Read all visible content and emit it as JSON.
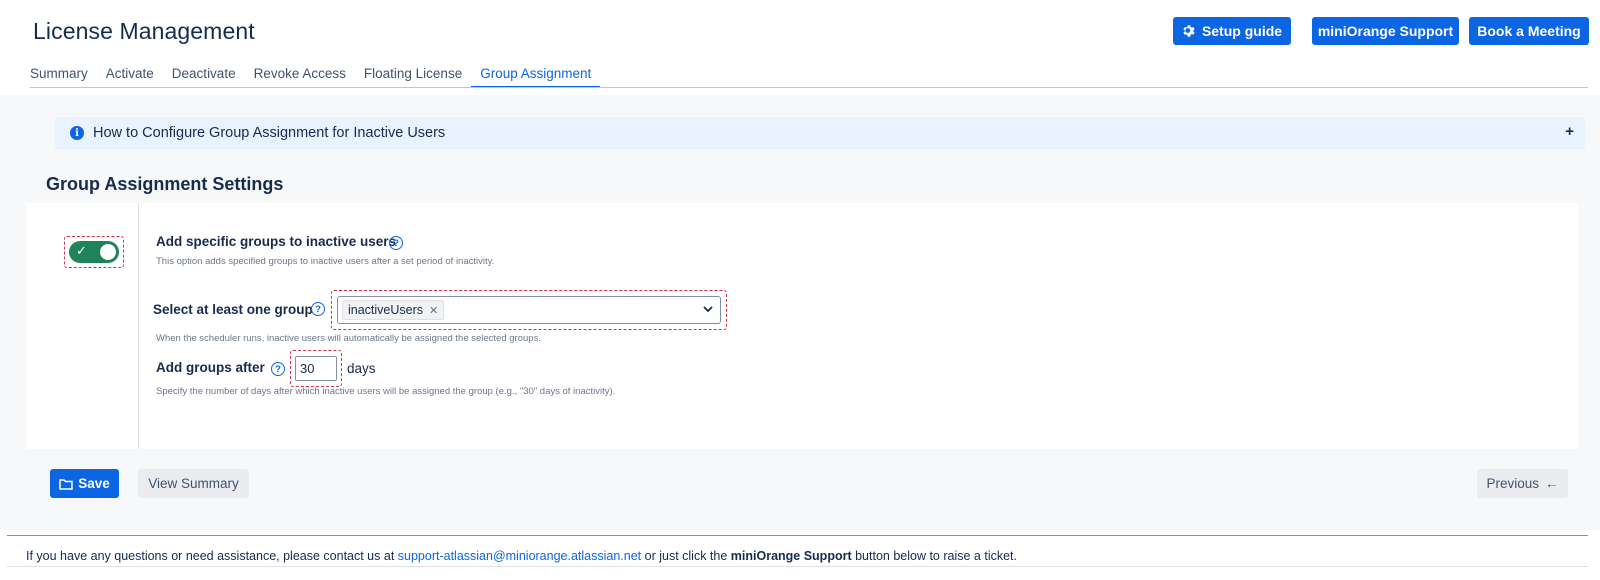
{
  "header": {
    "title": "License Management",
    "buttons": {
      "setup_guide": "Setup guide",
      "support": "miniOrange Support",
      "meeting": "Book a Meeting"
    }
  },
  "tabs": [
    {
      "label": "Summary",
      "active": false
    },
    {
      "label": "Activate",
      "active": false
    },
    {
      "label": "Deactivate",
      "active": false
    },
    {
      "label": "Revoke Access",
      "active": false
    },
    {
      "label": "Floating License",
      "active": false
    },
    {
      "label": "Group Assignment",
      "active": true
    }
  ],
  "info_bar": {
    "icon": "info-icon",
    "text": "How to Configure Group Assignment for Inactive Users",
    "expand_symbol": "+"
  },
  "section": {
    "title": "Group Assignment Settings"
  },
  "settings": {
    "toggle": {
      "enabled": true
    },
    "option_label": "Add specific groups to inactive users",
    "option_desc": "This option adds specified groups to inactive users after a set period of inactivity.",
    "group_select": {
      "label": "Select at least one group",
      "selected": [
        "inactiveUsers"
      ],
      "desc": "When the scheduler runs, inactive users will automatically be assigned the selected groups."
    },
    "days": {
      "label": "Add groups after",
      "value": "30",
      "unit": "days",
      "desc": "Specify the number of days after which inactive users will be assigned the group (e.g., \"30\" days of inactivity)."
    }
  },
  "actions": {
    "save": "Save",
    "view_summary": "View Summary",
    "previous": "Previous",
    "previous_arrow": "←"
  },
  "footer": {
    "prefix": "If you have any questions or need assistance, please contact us at ",
    "email": "support-atlassian@miniorange.atlassian.net",
    "middle": " or just click the ",
    "bold": "miniOrange Support",
    "suffix": " button below to raise a ticket."
  },
  "colors": {
    "primary": "#0c66e4",
    "toggle_on": "#1f845a",
    "highlight_dash": "#c9374b",
    "info_bg": "#e9f2ff"
  }
}
